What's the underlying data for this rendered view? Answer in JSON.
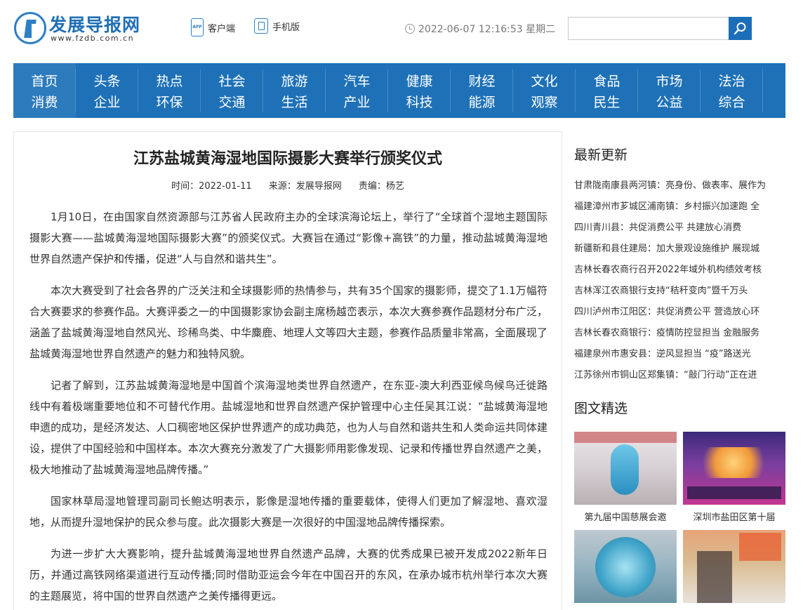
{
  "header": {
    "logo_title": "发展导报网",
    "logo_url": "www.fzdb.com.cn",
    "client_label": "客户端",
    "mobile_label": "手机版",
    "datetime": "2022-06-07 12:16:53 星期二",
    "search_value": ""
  },
  "nav": [
    {
      "top": "首页",
      "bottom": "消费"
    },
    {
      "top": "头条",
      "bottom": "企业"
    },
    {
      "top": "热点",
      "bottom": "环保"
    },
    {
      "top": "社会",
      "bottom": "交通"
    },
    {
      "top": "旅游",
      "bottom": "生活"
    },
    {
      "top": "汽车",
      "bottom": "产业"
    },
    {
      "top": "健康",
      "bottom": "科技"
    },
    {
      "top": "财经",
      "bottom": "能源"
    },
    {
      "top": "文化",
      "bottom": "观察"
    },
    {
      "top": "食品",
      "bottom": "民生"
    },
    {
      "top": "市场",
      "bottom": "公益"
    },
    {
      "top": "法治",
      "bottom": "综合"
    }
  ],
  "article": {
    "title": "江苏盐城黄海湿地国际摄影大赛举行颁奖仪式",
    "time": "时间：2022-01-11",
    "source": "来源：发展导报网",
    "editor": "责编：杨艺",
    "paragraphs": [
      "1月10日，在由国家自然资源部与江苏省人民政府主办的全球滨海论坛上，举行了“全球首个湿地主题国际摄影大赛——盐城黄海湿地国际摄影大赛”的颁奖仪式。大赛旨在通过“影像+高铁”的力量，推动盐城黄海湿地世界自然遗产保护和传播，促进“人与自然和谐共生”。",
      "本次大赛受到了社会各界的广泛关注和全球摄影师的热情参与，共有35个国家的摄影师，提交了1.1万幅符合大赛要求的参赛作品。大赛评委之一的中国摄影家协会副主席杨越峦表示，本次大赛参赛作品题材分布广泛，涵盖了盐城黄海湿地自然风光、珍稀鸟类、中华麋鹿、地理人文等四大主题，参赛作品质量非常高，全面展现了盐城黄海湿地世界自然遗产的魅力和独特风貌。",
      "记者了解到，江苏盐城黄海湿地是中国首个滨海湿地类世界自然遗产，在东亚-澳大利西亚候鸟候鸟迁徙路线中有着极端重要地位和不可替代作用。盐城湿地和世界自然遗产保护管理中心主任吴其江说：“盐城黄海湿地申遗的成功，是经济发达、人口稠密地区保护世界遗产的成功典范，也为人与自然和谐共生和人类命运共同体建设，提供了中国经验和中国样本。本次大赛充分激发了广大摄影师用影像发现、记录和传播世界自然遗产之美，极大地推动了盐城黄海湿地品牌传播。”",
      "国家林草局湿地管理司副司长鲍达明表示，影像是湿地传播的重要载体，使得人们更加了解湿地、喜欢湿地，从而提升湿地保护的民众参与度。此次摄影大赛是一次很好的中国湿地品牌传播探索。",
      "为进一步扩大大赛影响，提升盐城黄海湿地世界自然遗产品牌，大赛的优秀成果已被开发成2022新年日历，并通过高铁网络渠道进行互动传播;同时借助亚运会今年在中国召开的东风，在承办城市杭州举行本次大赛的主题展览，将中国的世界自然遗产之美传播得更远。"
    ]
  },
  "sidebar": {
    "latest_heading": "最新更新",
    "latest": [
      "甘肃陇南康县两河镇：亮身份、做表率、展作为",
      "福建漳州市芗城区浦南镇：乡村振兴加速跑 全",
      "四川青川县：共促消费公平 共建放心消费",
      "新疆新和县住建局：加大景观设施维护 展现城",
      "吉林长春农商行召开2022年域外机构绩效考核",
      "吉林浑江农商银行支持“秸秆变肉”暨千万头",
      "四川泸州市江阳区：共促消费公平 营造放心环",
      "吉林长春农商银行：疫情防控显担当 金融服务",
      "福建泉州市惠安县：逆风显担当 “疫”路送光",
      "江苏徐州市铜山区郑集镇：“敲门行动”正在进"
    ],
    "pics_heading": "图文精选",
    "pics": [
      {
        "caption": "第九届中国慈展会邀"
      },
      {
        "caption": "深圳市盐田区第十届"
      },
      {
        "caption": ""
      },
      {
        "caption": ""
      }
    ]
  }
}
